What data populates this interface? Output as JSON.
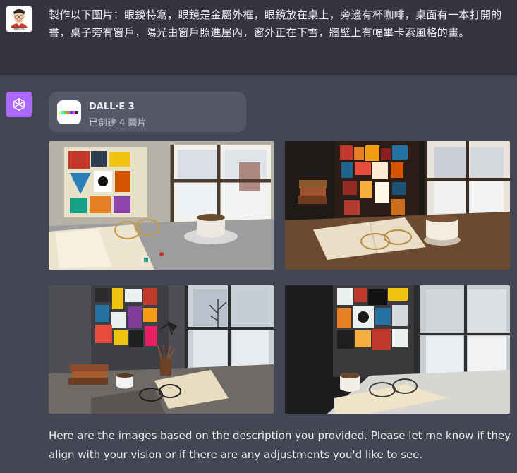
{
  "user": {
    "avatar_label": "Teacher",
    "message": "製作以下圖片：眼鏡特寫，眼鏡是金屬外框，眼鏡放在桌上，旁邊有杯咖啡，桌面有一本打開的書，桌子旁有窗戶，陽光由窗戶照進屋內，窗外正在下雪，牆壁上有幅畢卡索風格的畫。"
  },
  "assistant": {
    "avatar_icon": "openai-logo-icon",
    "tool_card": {
      "title": "DALL·E 3",
      "subtitle": "已創建 4 圖片"
    },
    "images": [
      {
        "name": "generated-image-1"
      },
      {
        "name": "generated-image-2"
      },
      {
        "name": "generated-image-3"
      },
      {
        "name": "generated-image-4"
      }
    ],
    "reply": "Here are the images based on the description you provided. Please let me know if they align with your vision or if there are any adjustments you'd like to see."
  },
  "colors": {
    "user_bg": "#343541",
    "assistant_bg": "#444654",
    "gpt_avatar": "#ab68ff",
    "card_bg": "#565869",
    "text": "#ececf1"
  }
}
